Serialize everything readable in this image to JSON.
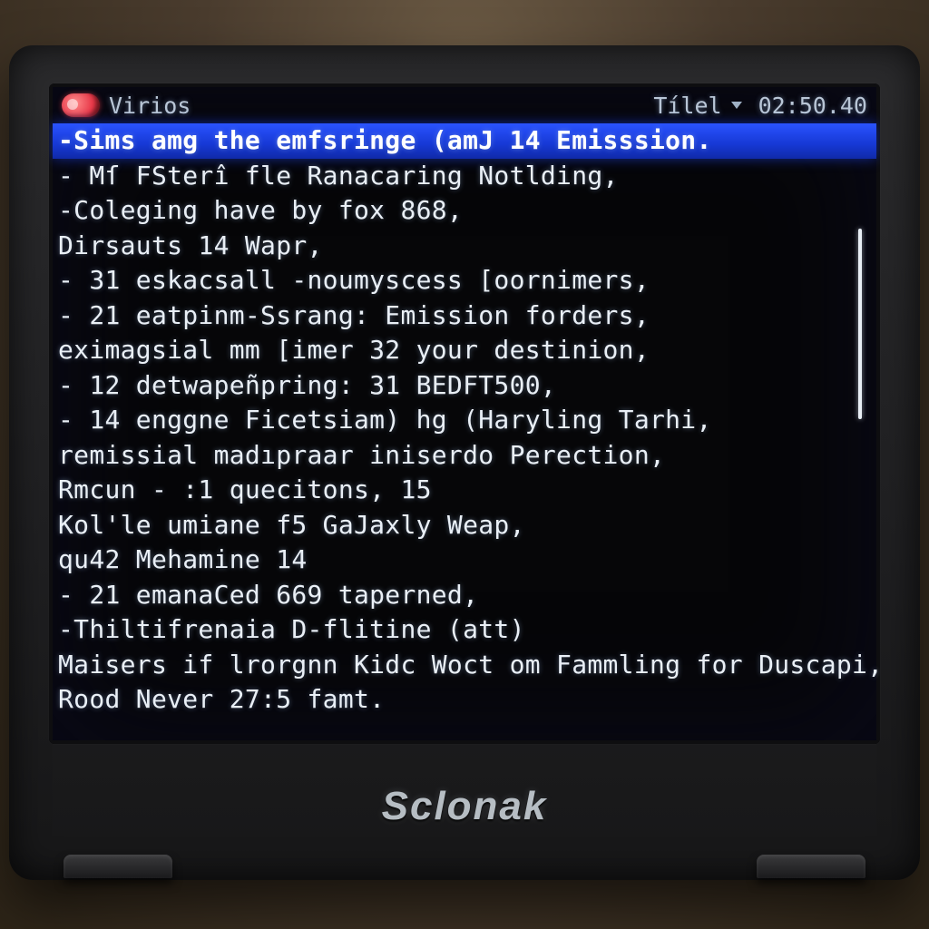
{
  "titlebar": {
    "app_name": "Virios",
    "right_label": "Tílel",
    "clock": "02:50.40"
  },
  "listing": {
    "selected_index": 0,
    "lines": [
      "-Sims amg the emfsringe (amJ 14 Emisssion.",
      " - Mſ FSterî fle Ranacaring Notlding,",
      "-Coleging have by fox 868,",
      "Dirsauts 14 Wapr,",
      " - 31 eskacsall -noumyscess [oornimers,",
      " - 21 eatpinm-Ssrang: Emission forders,",
      "eximagsial mm [imer 32 your destinion,",
      " - 12 detwapeñpring: 31 BEDFT500,",
      " - 14 enggne Ficetsiam) hg (Haryling Tarhi,",
      "remissial madıpraar iniserdo Perection,",
      "Rmcun -  :1 quecitons, 15",
      "Kol'le umiane f5 GaJaxly Weap,",
      " qu42 Mehamine 14",
      " - 21 emanaCed 669 taperned,",
      "-Thiltifrenaia D-flitine (att)",
      "Maisers if lrorgnn Kidc Woct om Fammling for Duscapi,",
      "Rood Never 27:5 famt."
    ]
  },
  "device": {
    "brand": "Sclonak"
  }
}
